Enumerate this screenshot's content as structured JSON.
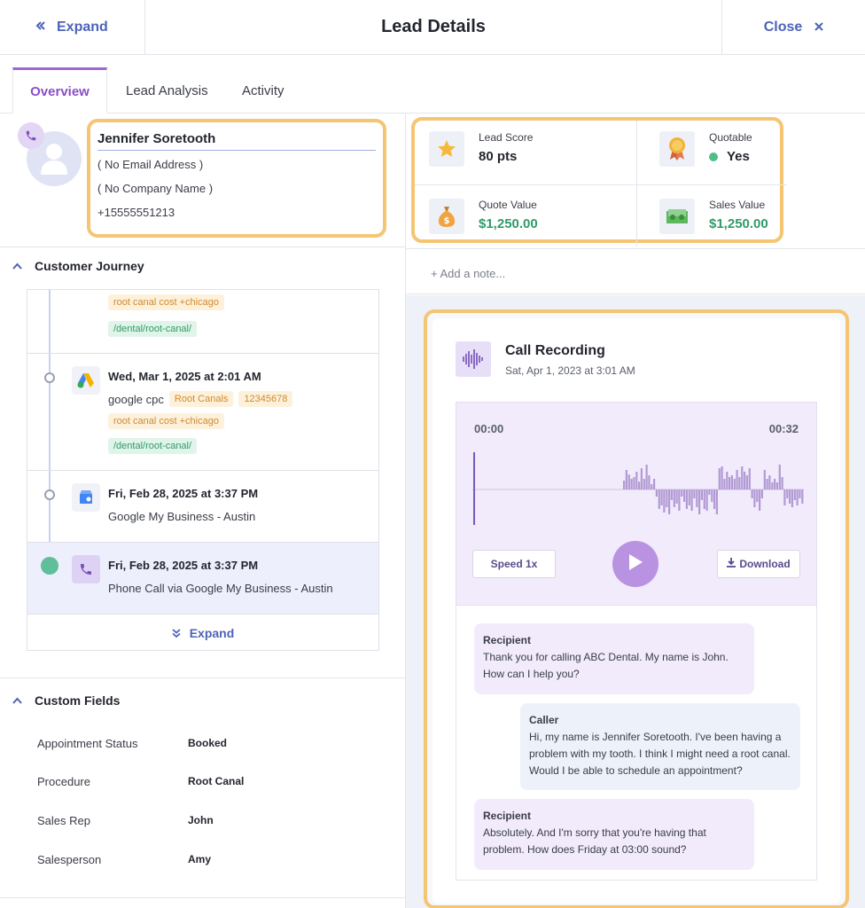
{
  "header": {
    "expand_label": "Expand",
    "title": "Lead Details",
    "close_label": "Close"
  },
  "tabs": [
    {
      "label": "Overview"
    },
    {
      "label": "Lead Analysis"
    },
    {
      "label": "Activity"
    }
  ],
  "contact": {
    "name": "Jennifer Soretooth",
    "email": "( No Email Address )",
    "company": "( No Company Name )",
    "phone": "+15555551213"
  },
  "metrics": {
    "lead_score_label": "Lead Score",
    "lead_score_value": "80 pts",
    "quotable_label": "Quotable",
    "quotable_value": "Yes",
    "quote_value_label": "Quote Value",
    "quote_value": "$1,250.00",
    "sales_value_label": "Sales Value",
    "sales_value": "$1,250.00"
  },
  "note_placeholder": "+ Add a note...",
  "journey": {
    "title": "Customer Journey",
    "entries": [
      {
        "tags": [
          "root canal cost +chicago"
        ],
        "path": "/dental/root-canal/"
      },
      {
        "date": "Wed, Mar 1, 2025 at 2:01 AM",
        "source": "google cpc",
        "tags": [
          "Root Canals",
          "12345678"
        ],
        "tags2": [
          "root canal cost +chicago"
        ],
        "path": "/dental/root-canal/"
      },
      {
        "date": "Fri, Feb 28, 2025 at 3:37 PM",
        "source": "Google My Business - Austin"
      },
      {
        "date": "Fri, Feb 28, 2025 at 3:37 PM",
        "source": "Phone Call via Google My Business - Austin"
      }
    ],
    "expand_label": "Expand"
  },
  "custom_fields": {
    "title": "Custom Fields",
    "rows": [
      {
        "label": "Appointment Status",
        "value": "Booked"
      },
      {
        "label": "Procedure",
        "value": "Root Canal"
      },
      {
        "label": "Sales Rep",
        "value": "John"
      },
      {
        "label": "Salesperson",
        "value": "Amy"
      }
    ]
  },
  "recording": {
    "title": "Call Recording",
    "date": "Sat, Apr 1, 2023 at 3:01 AM",
    "time_start": "00:00",
    "time_end": "00:32",
    "speed_label": "Speed 1x",
    "download_label": "Download",
    "waveform": [
      0,
      0,
      0,
      0,
      0,
      0,
      0,
      0,
      0,
      0,
      0,
      0,
      0,
      0,
      0,
      0,
      0,
      0,
      0,
      0,
      0,
      0,
      0,
      0,
      0,
      0,
      0,
      0,
      0,
      0,
      0,
      0,
      0,
      0,
      0,
      0,
      0,
      0,
      0,
      0,
      0,
      0,
      0,
      0,
      0,
      0,
      0,
      0,
      0,
      0,
      0,
      0,
      0,
      0,
      0,
      0,
      0,
      0,
      0,
      0,
      0.25,
      0.55,
      0.42,
      0.3,
      0.35,
      0.5,
      0.22,
      0.6,
      0.3,
      0.7,
      0.4,
      0.15,
      0.3,
      -0.2,
      -0.55,
      -0.45,
      -0.65,
      -0.5,
      -0.7,
      -0.3,
      -0.5,
      -0.4,
      -0.6,
      -0.2,
      -0.35,
      -0.55,
      -0.45,
      -0.6,
      -0.25,
      -0.5,
      -0.7,
      -0.3,
      -0.55,
      -0.6,
      -0.15,
      -0.35,
      -0.55,
      -0.7,
      0.6,
      0.65,
      0.3,
      0.5,
      0.35,
      0.4,
      0.3,
      0.55,
      0.35,
      0.65,
      0.5,
      0.4,
      0.6,
      -0.25,
      -0.5,
      -0.35,
      -0.6,
      -0.25,
      0.55,
      0.3,
      0.4,
      0.2,
      0.3,
      0.2,
      0.7,
      0.35,
      -0.45,
      -0.25,
      -0.4,
      -0.5,
      -0.3,
      -0.45,
      -0.25,
      -0.4
    ],
    "transcript": [
      {
        "role": "Recipient",
        "text": "Thank you for calling ABC Dental. My name is John. How can I help you?"
      },
      {
        "role": "Caller",
        "text": "Hi, my name is Jennifer Soretooth. I've been having a problem with my tooth. I think I might need a root canal. Would I be able to schedule an appointment?"
      },
      {
        "role": "Recipient",
        "text": "Absolutely. And I'm sorry that you're having that problem. How does Friday at 03:00 sound?"
      }
    ]
  },
  "colors": {
    "accent": "#4d63b8",
    "highlight_border": "#f5c574",
    "purple": "#a064d6",
    "green": "#2f9b68"
  }
}
